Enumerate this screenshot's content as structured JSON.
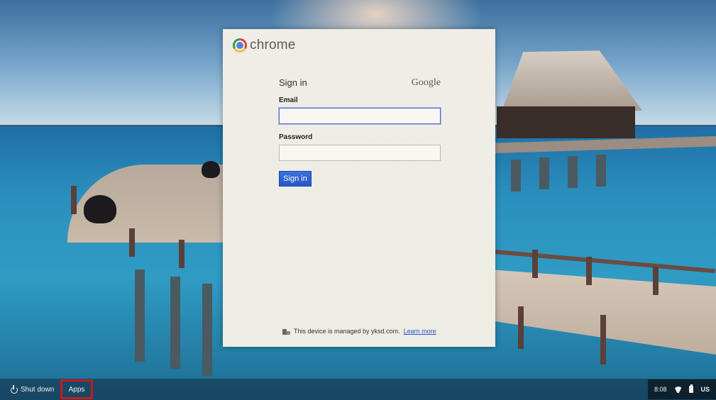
{
  "window": {
    "brand": "chrome"
  },
  "signin": {
    "title": "Sign in",
    "provider": "Google",
    "email_label": "Email",
    "email_value": "",
    "password_label": "Password",
    "password_value": "",
    "button_label": "Sign in"
  },
  "footer": {
    "managed_text": "This device is managed by yksd.com.",
    "learn_more": "Learn more",
    "icon": "building-icon"
  },
  "shelf": {
    "shutdown_label": "Shut down",
    "apps_label": "Apps",
    "highlight_color": "#c21c1c"
  },
  "tray": {
    "time": "8:08",
    "input_method": "US",
    "icons": [
      "wifi-icon",
      "battery-icon"
    ]
  },
  "colors": {
    "accent": "#2555c6",
    "link": "#2a52c9",
    "dialog_bg": "#efede6"
  }
}
